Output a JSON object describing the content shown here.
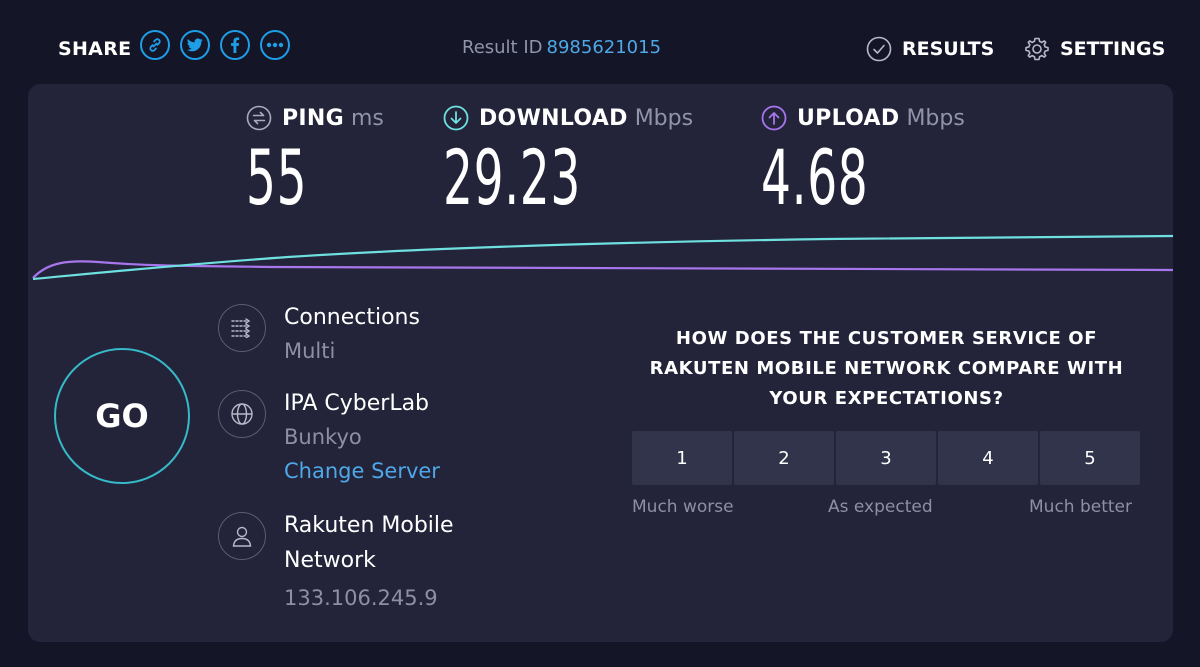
{
  "share": {
    "label": "SHARE",
    "icons": [
      "link-icon",
      "twitter-icon",
      "facebook-icon",
      "more-icon"
    ]
  },
  "result": {
    "label": "Result ID",
    "id": "8985621015"
  },
  "nav": {
    "results": "RESULTS",
    "settings": "SETTINGS"
  },
  "metrics": {
    "ping": {
      "name": "PING",
      "unit": "ms",
      "value": "55"
    },
    "download": {
      "name": "DOWNLOAD",
      "unit": "Mbps",
      "value": "29.23"
    },
    "upload": {
      "name": "UPLOAD",
      "unit": "Mbps",
      "value": "4.68"
    }
  },
  "go": "GO",
  "info": {
    "connections": {
      "title": "Connections",
      "value": "Multi"
    },
    "server": {
      "title": "IPA CyberLab",
      "location": "Bunkyo",
      "change": "Change Server"
    },
    "provider": {
      "title_line1": "Rakuten Mobile",
      "title_line2": "Network",
      "ip": "133.106.245.9"
    }
  },
  "survey": {
    "question": "HOW DOES THE CUSTOMER SERVICE OF RAKUTEN MOBILE NETWORK COMPARE WITH YOUR EXPECTATIONS?",
    "options": [
      "1",
      "2",
      "3",
      "4",
      "5"
    ],
    "low_label": "Much worse",
    "mid_label": "As expected",
    "high_label": "Much better"
  },
  "colors": {
    "background": "#141526",
    "panel": "#232439",
    "accent_blue": "#1f9ee8",
    "download": "#6fe0e0",
    "upload": "#a775ec"
  }
}
